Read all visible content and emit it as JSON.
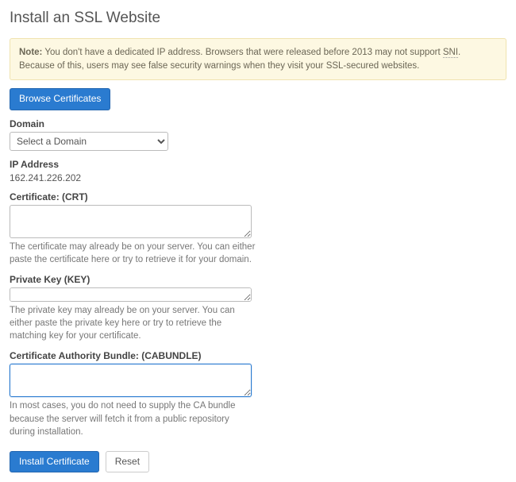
{
  "page": {
    "title": "Install an SSL Website"
  },
  "note": {
    "label": "Note:",
    "text_before": " You don't have a dedicated IP address. Browsers that were released before 2013 may not support ",
    "abbr": "SNI",
    "text_after": ". Because of this, users may see false security warnings when they visit your SSL-secured websites."
  },
  "buttons": {
    "browse": "Browse Certificates",
    "install": "Install Certificate",
    "reset": "Reset"
  },
  "domain": {
    "label": "Domain",
    "selected": "Select a Domain"
  },
  "ip": {
    "label": "IP Address",
    "value": "162.241.226.202"
  },
  "crt": {
    "label": "Certificate: (CRT)",
    "help": "The certificate may already be on your server. You can either paste the certificate here or try to retrieve it for your domain."
  },
  "key": {
    "label": "Private Key (KEY)",
    "help": "The private key may already be on your server. You can either paste the private key here or try to retrieve the matching key for your certificate."
  },
  "cab": {
    "label": "Certificate Authority Bundle: (CABUNDLE)",
    "help": "In most cases, you do not need to supply the CA bundle because the server will fetch it from a public repository during installation."
  }
}
